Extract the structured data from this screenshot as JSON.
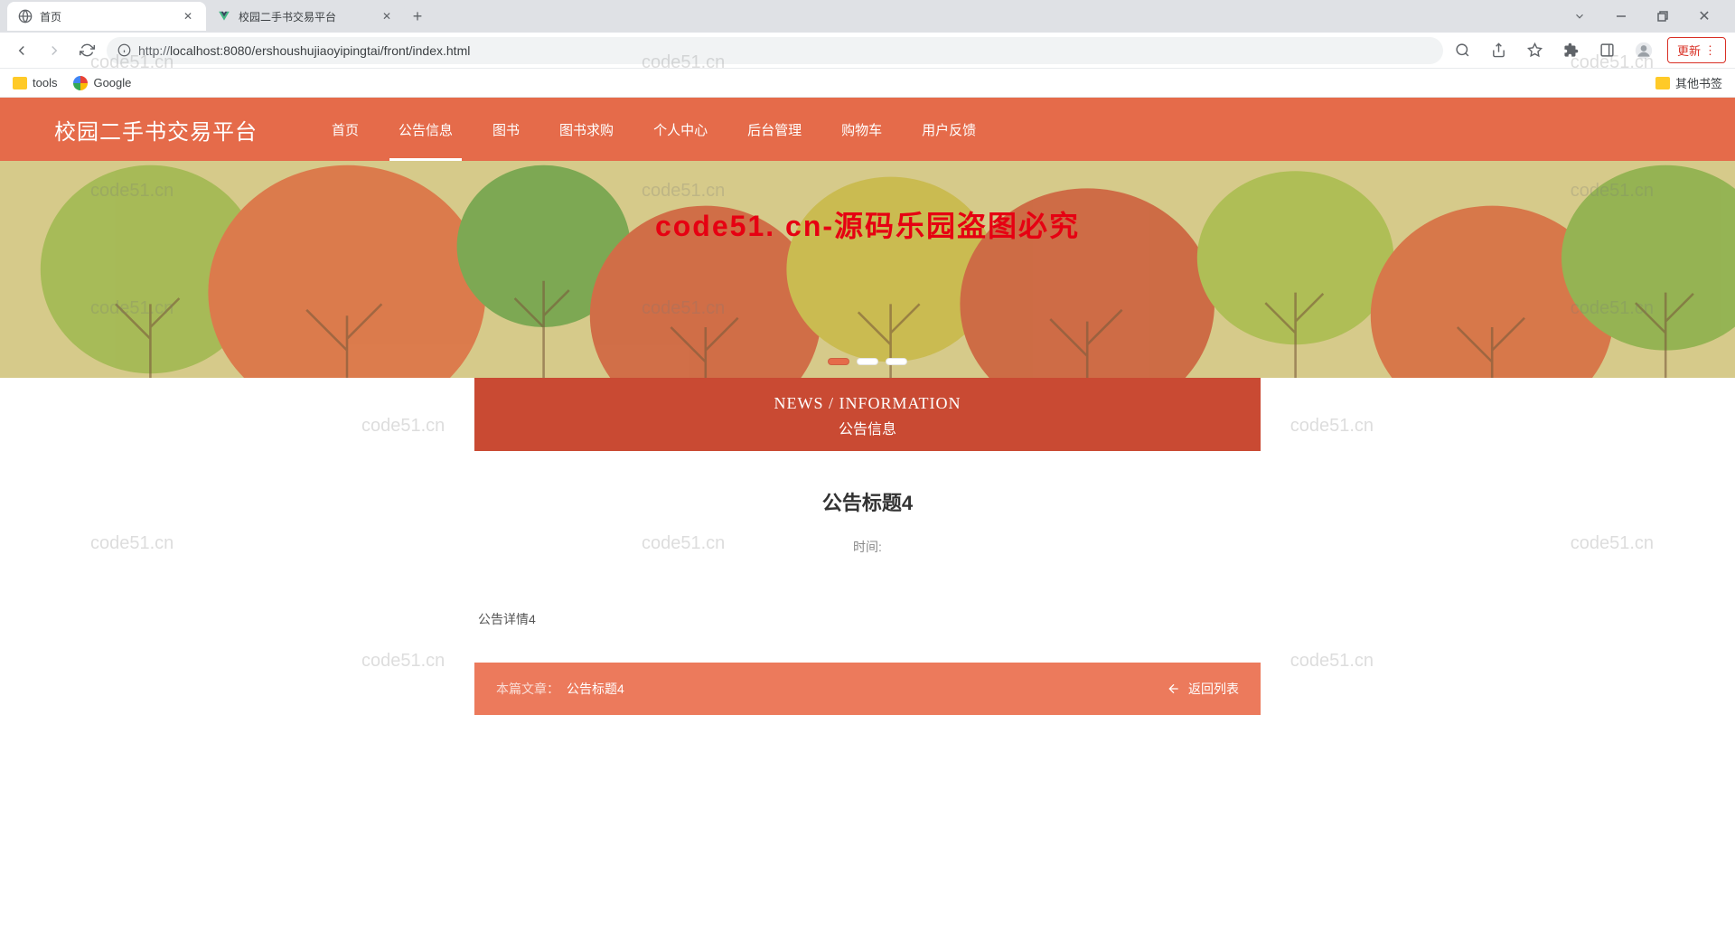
{
  "browser": {
    "tabs": [
      {
        "title": "首页",
        "active": true
      },
      {
        "title": "校园二手书交易平台",
        "active": false
      }
    ],
    "url_protocol": "http://",
    "url_rest": "localhost:8080/ershoushujiaoyipingtai/front/index.html",
    "update_label": "更新",
    "bookmarks": {
      "tools": "tools",
      "google": "Google",
      "other": "其他书签"
    }
  },
  "site": {
    "logo": "校园二手书交易平台",
    "nav": [
      "首页",
      "公告信息",
      "图书",
      "图书求购",
      "个人中心",
      "后台管理",
      "购物车",
      "用户反馈"
    ],
    "nav_active_index": 1
  },
  "section": {
    "title_en": "NEWS / INFORMATION",
    "title_cn": "公告信息"
  },
  "article": {
    "title": "公告标题4",
    "time_label": "时间:",
    "body": "公告详情4"
  },
  "footer": {
    "label": "本篇文章：",
    "value": "公告标题4",
    "back": "返回列表"
  },
  "watermark": {
    "red": "code51. cn-源码乐园盗图必究",
    "grey": "code51.cn"
  }
}
